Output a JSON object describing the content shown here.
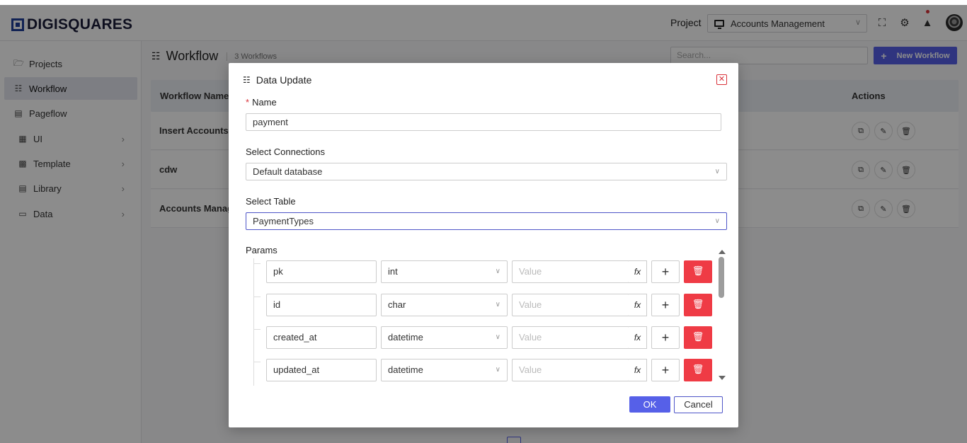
{
  "topbar": {
    "logo": "DIGISQUARES",
    "project_label": "Project",
    "project_value": "Accounts Management"
  },
  "sidebar": {
    "items": [
      {
        "label": "Projects",
        "icon": "folder-icon"
      },
      {
        "label": "Workflow",
        "icon": "workflow-icon"
      },
      {
        "label": "Pageflow",
        "icon": "pageflow-icon"
      },
      {
        "label": "UI",
        "icon": "ui-icon"
      },
      {
        "label": "Template",
        "icon": "template-icon"
      },
      {
        "label": "Library",
        "icon": "library-icon"
      },
      {
        "label": "Data",
        "icon": "data-icon"
      }
    ]
  },
  "content": {
    "title": "Workflow",
    "count": "3 Workflows",
    "search_placeholder": "Search...",
    "new_button": "New Workflow",
    "columns": {
      "name": "Workflow Name",
      "actions": "Actions"
    },
    "rows": [
      "Insert Accounts",
      "cdw",
      "Accounts Manag"
    ]
  },
  "modal": {
    "title": "Data Update",
    "name_label": "Name",
    "name_value": "payment",
    "connections_label": "Select Connections",
    "connections_value": "Default database",
    "table_label": "Select Table",
    "table_value": "PaymentTypes",
    "params_label": "Params",
    "value_placeholder": "Value",
    "fx_label": "fx",
    "params": [
      {
        "field": "pk",
        "type": "int"
      },
      {
        "field": "id",
        "type": "char"
      },
      {
        "field": "created_at",
        "type": "datetime"
      },
      {
        "field": "updated_at",
        "type": "datetime"
      }
    ],
    "ok": "OK",
    "cancel": "Cancel"
  },
  "colors": {
    "accent": "#5660e8",
    "danger": "#ef3b45",
    "brand": "#1f3f9a"
  }
}
